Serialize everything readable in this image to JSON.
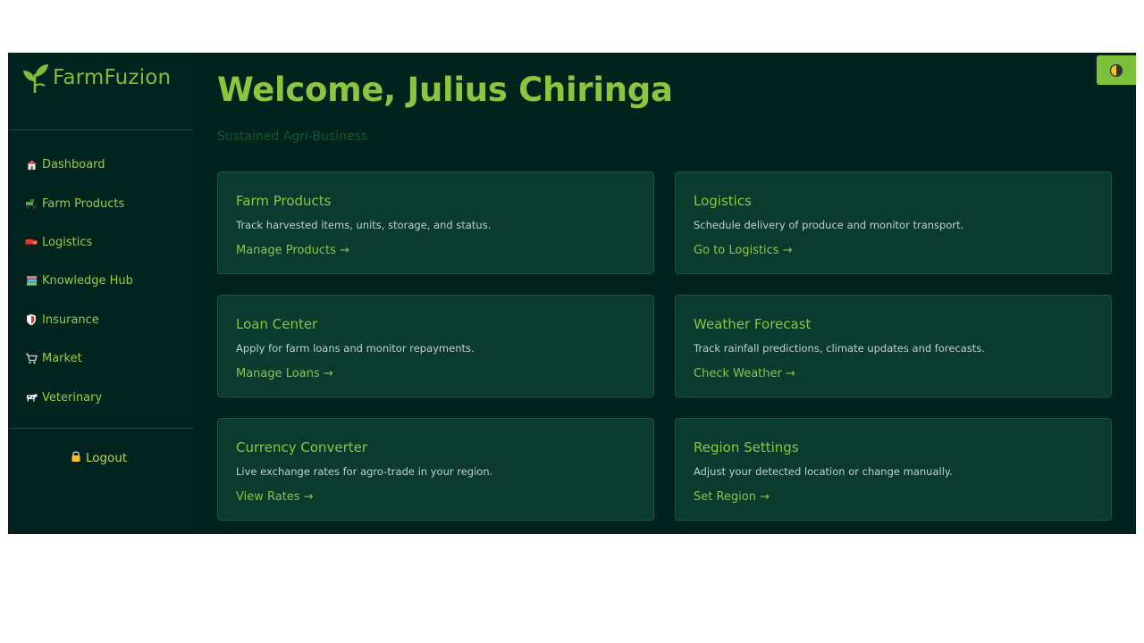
{
  "brand": {
    "name": "FarmFuzion",
    "icon": "sprout-icon"
  },
  "sidebar": {
    "items": [
      {
        "label": "Dashboard",
        "icon": "house-icon"
      },
      {
        "label": "Farm Products",
        "icon": "tractor-icon"
      },
      {
        "label": "Logistics",
        "icon": "truck-icon"
      },
      {
        "label": "Knowledge Hub",
        "icon": "books-icon"
      },
      {
        "label": "Insurance",
        "icon": "shield-icon"
      },
      {
        "label": "Market",
        "icon": "cart-icon"
      },
      {
        "label": "Veterinary",
        "icon": "cow-icon"
      }
    ],
    "logout": {
      "label": "Logout",
      "icon": "lock-icon"
    }
  },
  "header": {
    "title": "Welcome, Julius Chiringa",
    "subtitle": "Sustained Agri-Business"
  },
  "theme_toggle": {
    "icon": "half-moon-icon"
  },
  "cards": [
    {
      "title": "Farm Products",
      "description": "Track harvested items, units, storage, and status.",
      "link": "Manage Products →"
    },
    {
      "title": "Logistics",
      "description": "Schedule delivery of produce and monitor transport.",
      "link": "Go to Logistics →"
    },
    {
      "title": "Loan Center",
      "description": "Apply for farm loans and monitor repayments.",
      "link": "Manage Loans →"
    },
    {
      "title": "Weather Forecast",
      "description": "Track rainfall predictions, climate updates and forecasts.",
      "link": "Check Weather →"
    },
    {
      "title": "Currency Converter",
      "description": "Live exchange rates for agro-trade in your region.",
      "link": "View Rates →"
    },
    {
      "title": "Region Settings",
      "description": "Adjust your detected location or change manually.",
      "link": "Set Region →"
    }
  ],
  "colors": {
    "background": "#00221c",
    "accent": "#8cc63f",
    "card": "#0b3a2f"
  }
}
